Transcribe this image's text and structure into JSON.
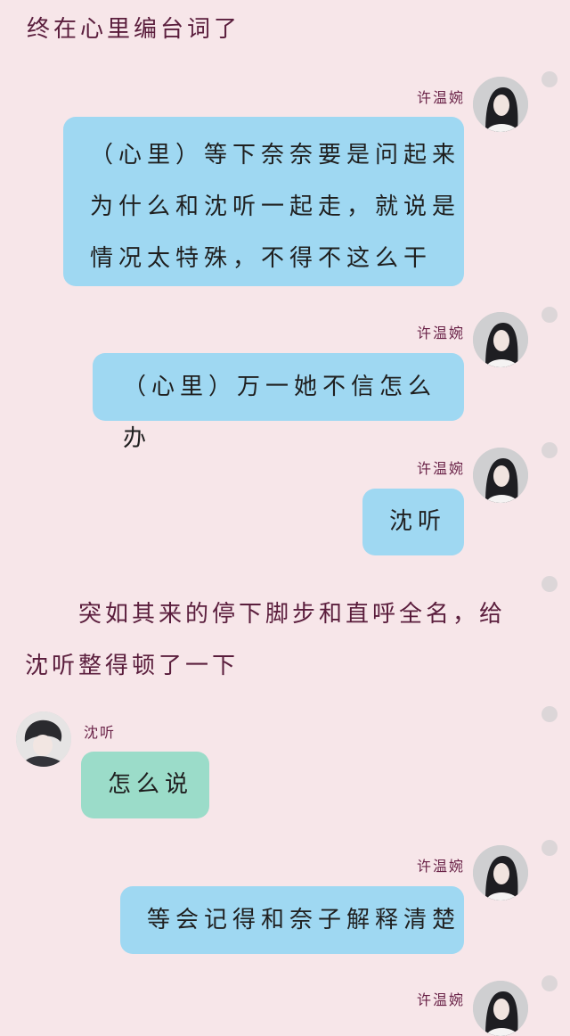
{
  "narration": [
    {
      "lines": [
        "终在心里编台词了"
      ]
    },
    {
      "lines": [
        "突如其来的停下脚步和直呼全名，给",
        "沈听整得顿了一下"
      ]
    }
  ],
  "messages": [
    {
      "sender": "许温婉",
      "lines": [
        "（心里）等下奈奈要是问起来",
        "为什么和沈听一起走，就说是",
        "情况太特殊，不得不这么干"
      ]
    },
    {
      "sender": "许温婉",
      "lines": [
        "（心里）万一她不信怎么办"
      ]
    },
    {
      "sender": "许温婉",
      "lines": [
        "沈听"
      ]
    },
    {
      "sender": "沈听",
      "lines": [
        "怎么说"
      ]
    },
    {
      "sender": "许温婉",
      "lines": [
        "等会记得和奈子解释清楚"
      ]
    },
    {
      "sender": "许温婉",
      "lines": []
    }
  ],
  "colors": {
    "background": "#f7e6e9",
    "my_bubble": "#9fd8f2",
    "other_bubble": "#9bdcc9",
    "text": "#1f1f1f",
    "name": "#6a2348"
  }
}
